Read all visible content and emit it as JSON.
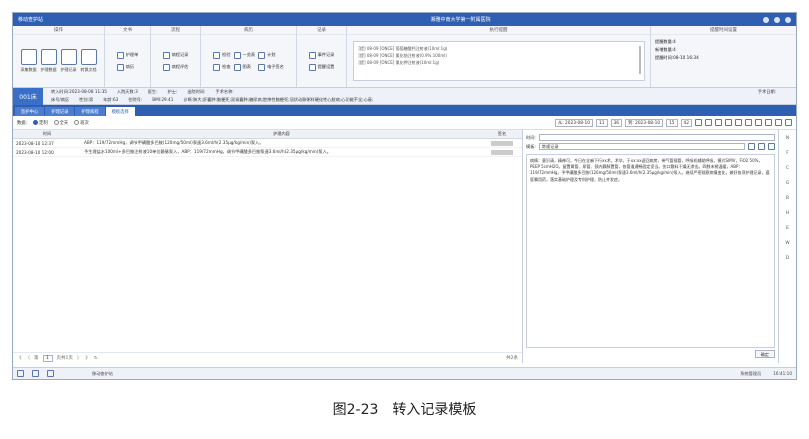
{
  "titlebar": {
    "app": "移动查护站",
    "center": "湘雅中南大学第一附属医院"
  },
  "ribbon": {
    "groups": {
      "g1": "操作",
      "g2": "文书",
      "g3": "流程",
      "g4": "病历",
      "g5": "记录",
      "g6": "执行提醒",
      "g7": "提醒时间设置"
    },
    "big": [
      "采集数据",
      "护理数据",
      "护理记录",
      "转换文档"
    ],
    "doc": [
      "护理单",
      "病历"
    ],
    "flow": [
      "病程记录",
      "病程评估"
    ],
    "emr": [
      "检验",
      "检查",
      "一览表",
      "图表",
      "计划",
      "电子签名",
      "生命体征",
      "影像"
    ],
    "rec": [
      "事件记录",
      "提醒设置"
    ],
    "messages": [
      "[提] 08-09 [ONCE] 葡萄糖酸钙注射液(10ml:1g)",
      "[提] 08-09 [ONCE] 氯化钠注射液(0.9%:100ml)",
      "[提] 08-09 [ONCE] 氯化钾注射液(10ml:1g)"
    ],
    "flags": [
      "提醒数量:4",
      "新增数量:4",
      "提醒时间:08-10 16:34"
    ]
  },
  "patient": {
    "bed": "001床",
    "row1": [
      "转入时间:2023-08-08 11:35",
      "入院天数:3",
      "医生:",
      "护士:",
      "出院时间:",
      "手术名称:"
    ],
    "row2": [
      "床号/病区",
      "性别:男",
      "年龄:63",
      "住院号:",
      "BMI:29.41",
      "诊断:肺大;肝囊肿;脑梗死;双肾囊肿;糖尿病;腔隙性脑梗死;冠状动脉粥样硬化性心脏病;心功能不全;心衰;"
    ],
    "surgery": "手术日期:"
  },
  "tabs": [
    "监护中心",
    "护理记录",
    "护理病程",
    "模板选择"
  ],
  "toolbar": {
    "label": "数据:",
    "opts": [
      "定制",
      "全天",
      "班次"
    ],
    "from": "从: 2023-08-10",
    "fh": "11",
    "fm": "36",
    "to": "到: 2023-08-10",
    "th": "15",
    "tm": "42"
  },
  "table": {
    "headers": [
      "时间",
      "护理内容",
      "签名"
    ],
    "rows": [
      {
        "time": "2023-08-10 12:37",
        "content": "ABP：119/72mmHg，调节甲磺酸多巴胺(120mg/50ml)泵速3.6ml/h(2.35μg/kg/min)泵入。"
      },
      {
        "time": "2023-08-10 12:00",
        "content": "予生理盐水100ml+多巴胺注射液10单位静脉泵入，ABP：119/72mmHg，调节甲磺酸多巴胺泵速3.6ml/h(2.35μg/kg/min)泵入。"
      }
    ]
  },
  "pager": {
    "first": "《",
    "prev": "〈",
    "label_left": "第",
    "page": "1",
    "label_right": "页共1页",
    "next": "〉",
    "last": "》",
    "refresh": "↻",
    "total": "共2条"
  },
  "editor": {
    "time_label": "时间:",
    "tpl_label": "模板:",
    "tpl_value": "常规记录",
    "text": "病情：意识清，精神可，今日在全麻下行xx术，术毕，于xx:xx返回病房，带气管插管，呼吸机辅助呼吸，模式SIMV，FiO2 50%，PEEP 5cmH2O。留置胃管、尿管、颈内静脉置管，各管道通畅固定妥当。伤口敷料干燥无渗出。四肢末梢温暖，ABP：119/72mmHg，予甲磺酸多巴胺(120mg/50ml)泵速3.6ml/h(2.35μg/kg/min)泵入。继续严密观察病情变化，做好各项护理记录，遵医嘱用药，落实基础护理及专科护理，防止并发症。",
    "ok": "确定"
  },
  "sidebar": [
    "N",
    "F",
    "C",
    "G",
    "B",
    "H",
    "E",
    "W",
    "D"
  ],
  "statusbar": {
    "task": "移动查护站",
    "user": "系统管理员",
    "time": "16:41:10"
  },
  "caption": "图2-23　转入记录模板"
}
